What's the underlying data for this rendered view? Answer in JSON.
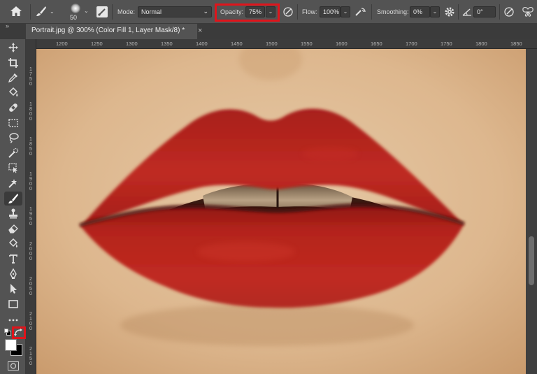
{
  "options_bar": {
    "brush_size": "50",
    "mode_label": "Mode:",
    "mode_value": "Normal",
    "opacity_label": "Opacity:",
    "opacity_value": "75%",
    "flow_label": "Flow:",
    "flow_value": "100%",
    "smoothing_label": "Smoothing:",
    "smoothing_value": "0%",
    "angle_value": "0°"
  },
  "document_tab": {
    "title": "Portrait.jpg @ 300% (Color Fill 1, Layer Mask/8) *",
    "close_glyph": "×"
  },
  "panel_collapse_glyph": "»",
  "ruler": {
    "horizontal": [
      "1200",
      "1250",
      "1300",
      "1350",
      "1400",
      "1450",
      "1500",
      "1550",
      "1600",
      "1650",
      "1700",
      "1750",
      "1800",
      "1850"
    ],
    "vertical": [
      "1750",
      "1800",
      "1850",
      "1900",
      "1950",
      "2000",
      "2050",
      "2100",
      "2150"
    ]
  },
  "toolbar": {
    "tools": [
      "move-tool",
      "crop-tool",
      "eyedropper-tool",
      "paint-bucket-tool",
      "healing-brush-tool",
      "marquee-tool",
      "lasso-tool",
      "quick-selection-tool",
      "object-selection-tool",
      "color-replacement-tool",
      "brush-tool",
      "clone-stamp-tool",
      "eraser-tool",
      "gradient-tool",
      "type-tool",
      "pen-tool",
      "path-selection-tool",
      "rectangle-tool",
      "more-tools"
    ],
    "active_tool": "brush-tool",
    "foreground_color": "#ffffff",
    "background_color": "#000000"
  },
  "colors": {
    "highlight": "#e0141b",
    "panel": "#535353",
    "lip_red": "#b3221c",
    "skin": "#dcb893"
  }
}
